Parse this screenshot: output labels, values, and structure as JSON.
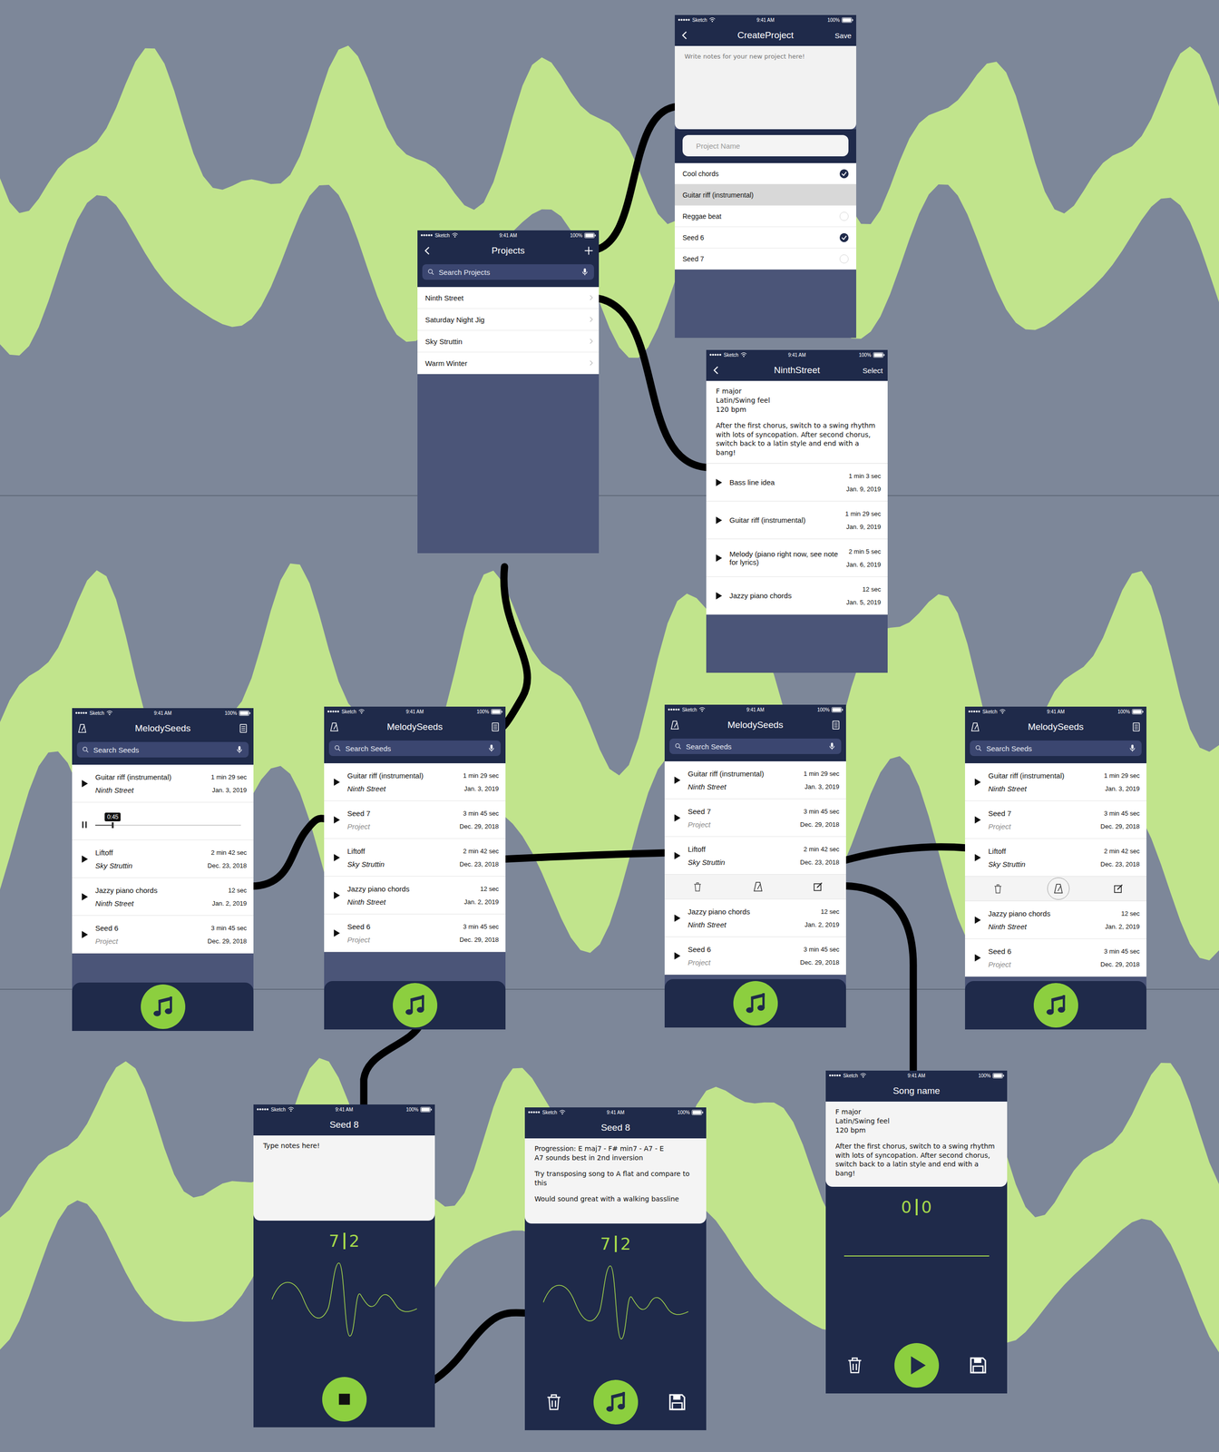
{
  "status_bar": {
    "carrier": "Sketch",
    "time": "9:41 AM",
    "battery": "100%"
  },
  "screens": [
    {
      "kind": "create-project",
      "title": "CreateProject",
      "action": "Save",
      "notes_placeholder": "Write notes for your new project here!",
      "name_placeholder": "Project Name",
      "seeds": [
        {
          "name": "Cool chords",
          "checked": true,
          "highlighted": false
        },
        {
          "name": "Guitar riff (instrumental)",
          "checked": false,
          "highlighted": true
        },
        {
          "name": "Reggae beat",
          "checked": false,
          "highlighted": false
        },
        {
          "name": "Seed 6",
          "checked": true,
          "highlighted": false
        },
        {
          "name": "Seed 7",
          "checked": false,
          "highlighted": false
        }
      ]
    },
    {
      "kind": "projects",
      "title": "Projects",
      "search": "Search Projects",
      "projects": [
        "Ninth Street",
        "Saturday Night Jig",
        "Sky Struttin",
        "Warm Winter"
      ]
    },
    {
      "kind": "project-detail",
      "title": "NinthStreet",
      "action": "Select",
      "notes": [
        "F major\nLatin/Swing feel\n120 bpm",
        "After the first chorus, switch to a swing rhythm with lots of syncopation. After second chorus, switch back to a latin style and end with a bang!"
      ],
      "tracks": [
        {
          "name": "Bass line idea",
          "duration": "1 min 3 sec",
          "date": "Jan. 9, 2019"
        },
        {
          "name": "Guitar riff (instrumental)",
          "duration": "1 min 29 sec",
          "date": "Jan. 9, 2019"
        },
        {
          "name": "Melody (piano right now, see note for lyrics)",
          "duration": "2 min 5 sec",
          "date": "Jan. 6, 2019"
        },
        {
          "name": "Jazzy piano chords",
          "duration": "12 sec",
          "date": "Jan. 5, 2019"
        }
      ]
    },
    {
      "kind": "seeds",
      "title": "MelodySeeds",
      "search": "Search Seeds",
      "rows": [
        {
          "kind": "track",
          "name": "Guitar riff (instrumental)",
          "project": "Ninth Street",
          "greyed": false,
          "duration": "1 min 29 sec",
          "date": "Jan. 3, 2019"
        },
        {
          "kind": "player",
          "playing": true,
          "time": "0:45",
          "level": 0.12
        },
        {
          "kind": "track",
          "name": "Liftoff",
          "project": "Sky Struttin",
          "greyed": false,
          "duration": "2 min 42 sec",
          "date": "Dec. 23, 2018"
        },
        {
          "kind": "track",
          "name": "Jazzy piano chords",
          "project": "Ninth Street",
          "greyed": false,
          "duration": "12 sec",
          "date": "Jan. 2, 2019"
        },
        {
          "kind": "track",
          "name": "Seed 6",
          "project": "Project",
          "greyed": true,
          "duration": "3 min 45 sec",
          "date": "Dec. 29, 2018"
        }
      ]
    },
    {
      "kind": "seeds",
      "title": "MelodySeeds",
      "search": "Search Seeds",
      "rows": [
        {
          "kind": "track",
          "name": "Guitar riff (instrumental)",
          "project": "Ninth Street",
          "greyed": false,
          "duration": "1 min 29 sec",
          "date": "Jan. 3, 2019"
        },
        {
          "kind": "track",
          "name": "Seed 7",
          "project": "Project",
          "greyed": true,
          "duration": "3 min 45 sec",
          "date": "Dec. 29, 2018"
        },
        {
          "kind": "track",
          "name": "Liftoff",
          "project": "Sky Struttin",
          "greyed": false,
          "duration": "2 min 42 sec",
          "date": "Dec. 23, 2018"
        },
        {
          "kind": "track",
          "name": "Jazzy piano chords",
          "project": "Ninth Street",
          "greyed": false,
          "duration": "12 sec",
          "date": "Jan. 2, 2019"
        },
        {
          "kind": "track",
          "name": "Seed 6",
          "project": "Project",
          "greyed": true,
          "duration": "3 min 45 sec",
          "date": "Dec. 29, 2018"
        }
      ]
    },
    {
      "kind": "seeds",
      "title": "MelodySeeds",
      "search": "Search Seeds",
      "rows": [
        {
          "kind": "track",
          "name": "Guitar riff (instrumental)",
          "project": "Ninth Street",
          "greyed": false,
          "duration": "1 min 29 sec",
          "date": "Jan. 3, 2019"
        },
        {
          "kind": "track",
          "name": "Seed 7",
          "project": "Project",
          "greyed": true,
          "duration": "3 min 45 sec",
          "date": "Dec. 29, 2018"
        },
        {
          "kind": "track",
          "name": "Liftoff",
          "project": "Sky Struttin",
          "greyed": false,
          "duration": "2 min 42 sec",
          "date": "Dec. 23, 2018"
        },
        {
          "kind": "actions",
          "metronome_selected": false
        },
        {
          "kind": "track",
          "name": "Jazzy piano chords",
          "project": "Ninth Street",
          "greyed": false,
          "duration": "12 sec",
          "date": "Jan. 2, 2019"
        },
        {
          "kind": "track",
          "name": "Seed 6",
          "project": "Project",
          "greyed": true,
          "duration": "3 min 45 sec",
          "date": "Dec. 29, 2018"
        }
      ]
    },
    {
      "kind": "seeds",
      "title": "MelodySeeds",
      "search": "Search Seeds",
      "rows": [
        {
          "kind": "track",
          "name": "Guitar riff (instrumental)",
          "project": "Ninth Street",
          "greyed": false,
          "duration": "1 min 29 sec",
          "date": "Jan. 3, 2019"
        },
        {
          "kind": "track",
          "name": "Seed 7",
          "project": "Project",
          "greyed": true,
          "duration": "3 min 45 sec",
          "date": "Dec. 29, 2018"
        },
        {
          "kind": "track",
          "name": "Liftoff",
          "project": "Sky Struttin",
          "greyed": false,
          "duration": "2 min 42 sec",
          "date": "Dec. 23, 2018"
        },
        {
          "kind": "actions",
          "metronome_selected": true
        },
        {
          "kind": "track",
          "name": "Jazzy piano chords",
          "project": "Ninth Street",
          "greyed": false,
          "duration": "12 sec",
          "date": "Jan. 2, 2019"
        },
        {
          "kind": "track",
          "name": "Seed 6",
          "project": "Project",
          "greyed": true,
          "duration": "3 min 45 sec",
          "date": "Dec. 29, 2018"
        }
      ]
    },
    {
      "kind": "recording",
      "title": "Seed 8",
      "notes_placeholder": "Type notes here!",
      "counter": [
        "7",
        "2"
      ],
      "recording": true
    },
    {
      "kind": "seed-detail",
      "title": "Seed 8",
      "notes": [
        "Progression: E maj7 - F# min7 - A7 - E\nA7 sounds best in 2nd inversion",
        "Try transposing song to A flat and compare to this",
        "Would sound great with a walking bassline"
      ],
      "counter": [
        "7",
        "2"
      ]
    },
    {
      "kind": "song",
      "title": "Song name",
      "notes": [
        "F major\nLatin/Swing feel\n120 bpm",
        "After the first chorus, switch to a swing rhythm with lots of syncopation. After second chorus, switch back to a latin style and end with a bang!"
      ],
      "counter": [
        "0",
        "0"
      ]
    }
  ]
}
